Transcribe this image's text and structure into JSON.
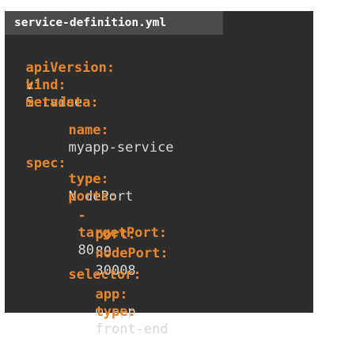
{
  "file_tab": {
    "filename": "service-definition.yml"
  },
  "colors": {
    "editor_background": "#2d2d2d",
    "tab_background": "#4b4b4b",
    "key_color": "#e8862a",
    "value_color": "#d8d8d8"
  },
  "code": {
    "api_version_key": "apiVersion:",
    "api_version_value": "v1",
    "kind_key": "kind:",
    "kind_value": "Service",
    "metadata_key": "metadata:",
    "name_key": "name:",
    "name_value": "myapp-service",
    "spec_key": "spec:",
    "type_key": "type:",
    "type_value": "NodePort",
    "ports_key": "ports:",
    "list_dash": "-",
    "target_port_key": "targetPort:",
    "target_port_value": "80",
    "port_key": "port:",
    "port_value": "80",
    "node_port_key": "nodePort:",
    "node_port_value": "30008",
    "selector_key": "selector:",
    "app_key": "app:",
    "app_value": "myapp",
    "selector_type_key": "type:",
    "selector_type_value": "front-end"
  }
}
